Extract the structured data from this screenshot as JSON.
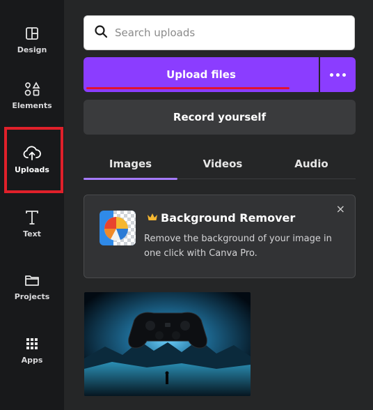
{
  "sidebar": {
    "items": [
      {
        "label": "Design",
        "icon": "design-icon"
      },
      {
        "label": "Elements",
        "icon": "elements-icon"
      },
      {
        "label": "Uploads",
        "icon": "cloud-upload-icon",
        "active": true
      },
      {
        "label": "Text",
        "icon": "text-icon"
      },
      {
        "label": "Projects",
        "icon": "folder-icon"
      },
      {
        "label": "Apps",
        "icon": "apps-grid-icon"
      }
    ]
  },
  "search": {
    "placeholder": "Search uploads",
    "value": ""
  },
  "upload_button": {
    "label": "Upload files"
  },
  "record_button": {
    "label": "Record yourself"
  },
  "tabs": [
    {
      "label": "Images",
      "active": true
    },
    {
      "label": "Videos"
    },
    {
      "label": "Audio"
    }
  ],
  "promo": {
    "title": "Background Remover",
    "description": "Remove the background of your image in one click with Canva Pro.",
    "close": "×"
  },
  "colors": {
    "accent": "#8b3dff",
    "panel_bg": "#252627",
    "rail_bg": "#18191b",
    "highlight": "#e0202a"
  }
}
